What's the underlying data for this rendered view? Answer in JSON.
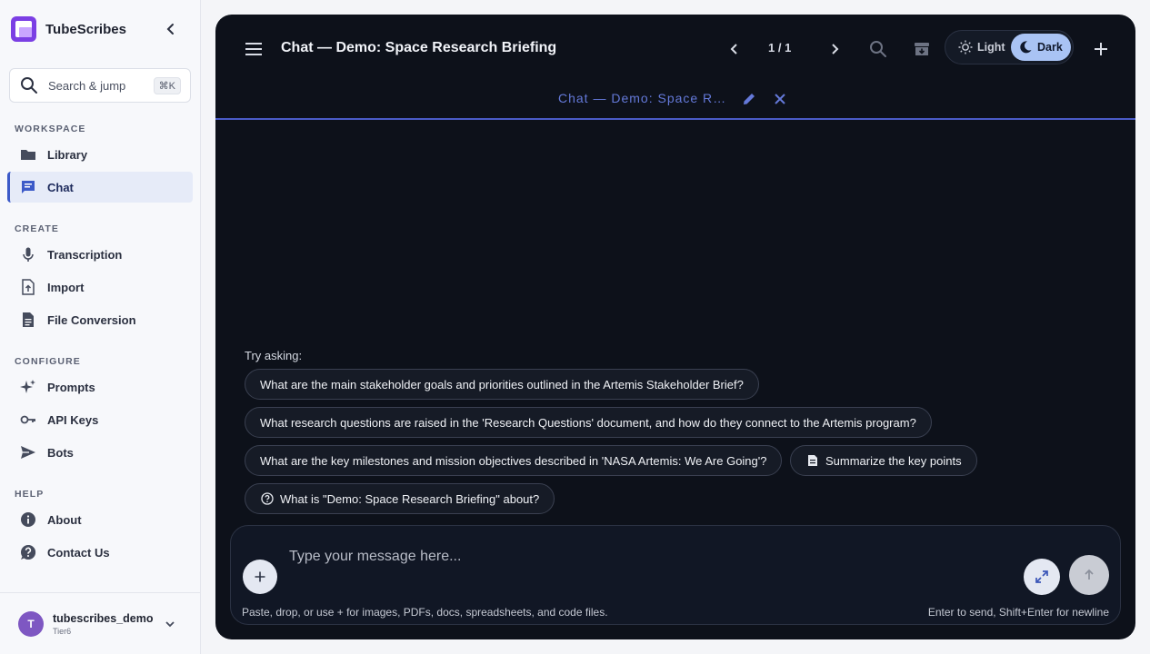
{
  "app": {
    "name": "TubeScribes"
  },
  "search": {
    "label": "Search & jump",
    "shortcut": "⌘K"
  },
  "sidebar": {
    "sections": [
      {
        "label": "WORKSPACE"
      },
      {
        "label": "CREATE"
      },
      {
        "label": "CONFIGURE"
      },
      {
        "label": "HELP"
      }
    ],
    "items": [
      {
        "label": "Library",
        "icon": "folder-icon"
      },
      {
        "label": "Chat",
        "icon": "chat-icon",
        "active": true
      },
      {
        "label": "Transcription",
        "icon": "mic-icon"
      },
      {
        "label": "Import",
        "icon": "upload-file-icon"
      },
      {
        "label": "File Conversion",
        "icon": "document-icon"
      },
      {
        "label": "Prompts",
        "icon": "sparkle-icon"
      },
      {
        "label": "API Keys",
        "icon": "key-icon"
      },
      {
        "label": "Bots",
        "icon": "send-icon"
      },
      {
        "label": "About",
        "icon": "info-icon"
      },
      {
        "label": "Contact Us",
        "icon": "help-icon"
      }
    ]
  },
  "user": {
    "initial": "T",
    "name": "tubescribes_demo",
    "tier": "Tier6"
  },
  "header": {
    "title": "Chat — Demo: Space Research Briefing",
    "page_counter": "1 / 1",
    "theme": {
      "light_label": "Light",
      "dark_label": "Dark",
      "selected": "Dark"
    }
  },
  "tab": {
    "title": "Chat — Demo: Space Research Briefing"
  },
  "suggestions": {
    "label": "Try asking:",
    "chips": [
      "What are the main stakeholder goals and priorities outlined in the Artemis Stakeholder Brief?",
      "What research questions are raised in the 'Research Questions' document, and how do they connect to the Artemis program?",
      "What are the key milestones and mission objectives described in 'NASA Artemis: We Are Going'?",
      "Summarize the key points",
      "What is \"Demo: Space Research Briefing\" about?"
    ]
  },
  "composer": {
    "placeholder": "Type your message here...",
    "hint_left": "Paste, drop, or use + for images, PDFs, docs, spreadsheets, and code files.",
    "hint_right": "Enter to send, Shift+Enter for newline"
  },
  "colors": {
    "accent": "#3c5ac8",
    "panel": "#0d111a",
    "dark_toggle": "#a9c3f4"
  }
}
